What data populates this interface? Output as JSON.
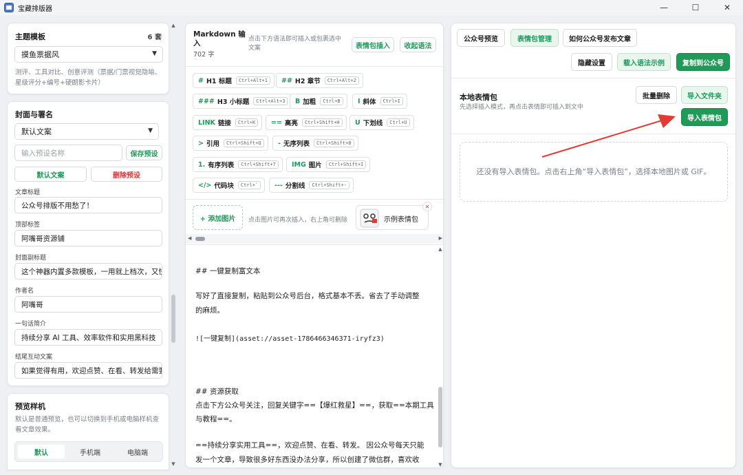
{
  "window": {
    "title": "宝藏排版器",
    "minimize": "—",
    "maximize": "☐",
    "close": "✕"
  },
  "left": {
    "theme": {
      "title": "主题模板",
      "count": "6 套",
      "selected": "摸鱼票据风",
      "desc": "测评、工具对比、创意评测（票据/门票视觉隐喻、星级评分+编号+硬朗影卡片）"
    },
    "cover": {
      "title": "封面与署名",
      "preset_selected": "默认文案",
      "preset_name_placeholder": "输入预设名称",
      "save_preset": "保存预设",
      "default_copy": "默认文案",
      "delete_preset": "删除预设",
      "fields": [
        {
          "label": "文章标题",
          "value": "公众号排版不用愁了！"
        },
        {
          "label": "顶部标签",
          "value": "阿嘴哥资源铺"
        },
        {
          "label": "封面副标题",
          "value": "这个神器内置多款模板，一用就上档次，又快"
        },
        {
          "label": "作者名",
          "value": "阿嘴哥"
        },
        {
          "label": "一句话简介",
          "value": "持续分享 AI 工具、效率软件和实用黑科技"
        },
        {
          "label": "结尾互动文案",
          "value": "如果觉得有用，欢迎点赞、在看、转发给需要"
        }
      ]
    },
    "preview": {
      "title": "预览样机",
      "desc": "默认是普通预览，也可以切换到手机或电脑样机查看文章效果。",
      "modes": [
        "默认",
        "手机端",
        "电脑端"
      ]
    }
  },
  "middle": {
    "title": "Markdown 输入",
    "word_count": "702 字",
    "hint": "点击下方语法即可插入或包裹选中文案",
    "sticker_insert": "表情包插入",
    "collapse_syntax": "收起语法",
    "syntax_buttons": [
      {
        "sym": "#",
        "name": "H1 标题",
        "kbd": "Ctrl+Alt+1"
      },
      {
        "sym": "##",
        "name": "H2 章节",
        "kbd": "Ctrl+Alt+2"
      },
      {
        "sym": "###",
        "name": "H3 小标题",
        "kbd": "Ctrl+Alt+3"
      },
      {
        "sym": "B",
        "name": "加粗",
        "kbd": "Ctrl+B"
      },
      {
        "sym": "I",
        "name": "斜体",
        "kbd": "Ctrl+I"
      },
      {
        "sym": "LINK",
        "name": "链接",
        "kbd": "Ctrl+K"
      },
      {
        "sym": "==",
        "name": "高亮",
        "kbd": "Ctrl+Shift+H"
      },
      {
        "sym": "U",
        "name": "下划线",
        "kbd": "Ctrl+U"
      },
      {
        "sym": ">",
        "name": "引用",
        "kbd": "Ctrl+Shift+Q"
      },
      {
        "sym": "-",
        "name": "无序列表",
        "kbd": "Ctrl+Shift+8"
      },
      {
        "sym": "1.",
        "name": "有序列表",
        "kbd": "Ctrl+Shift+7"
      },
      {
        "sym": "IMG",
        "name": "图片",
        "kbd": "Ctrl+Shift+I"
      },
      {
        "sym": "</>",
        "name": "代码块",
        "kbd": "Ctrl+`"
      },
      {
        "sym": "---",
        "name": "分割线",
        "kbd": "Ctrl+Shift+-"
      }
    ],
    "add_image": "+ 添加图片",
    "image_hint": "点击图片可再次插入，右上角可删除",
    "example_sticker": "示例表情包",
    "editor_lines": [
      "## 一键复制富文本",
      "写好了直接复制，粘贴到公众号后台，格式基本不丢。省去了手动调整",
      "的麻烦。",
      "![一键复制](asset://asset-1786466346371-iryfz3)",
      "## 资源获取",
      "点击下方公众号关注，回复关键字==【爆红救星】==，获取==本期工具",
      "与教程==。",
      "==持续分享实用工具==，欢迎点赞、在看、转发。 因公众号每天只能",
      "发一个文章，导致很多好东西没办法分享，所以创建了微信群，喜欢收"
    ]
  },
  "right": {
    "tabs": [
      "公众号预览",
      "表情包管理",
      "如何公众号发布文章"
    ],
    "hide_settings": "隐藏设置",
    "load_syntax_example": "载入语法示例",
    "copy_to_wechat": "复制到公众号",
    "local_stickers_title": "本地表情包",
    "local_stickers_desc": "先选择插入模式，再点击表情即可插入到文中",
    "batch_delete": "批量删除",
    "import_folder": "导入文件夹",
    "import_sticker": "导入表情包",
    "empty_text": "还没有导入表情包。点击右上角“导入表情包”，选择本地图片或 GIF。",
    "accent_green": "#1f9a57",
    "arrow_red": "#e53935"
  }
}
